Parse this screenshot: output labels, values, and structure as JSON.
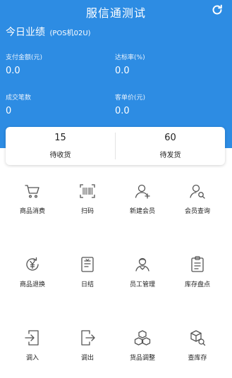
{
  "header": {
    "title": "服信通测试",
    "today_label": "今日业绩",
    "pos_label": "(POS机02U)",
    "refresh_icon": "refresh-icon",
    "bg_color": "#2d8ce3"
  },
  "metrics": [
    {
      "label": "支付金额(元)",
      "value": "0.0"
    },
    {
      "label": "达标率(%)",
      "value": "0.0"
    },
    {
      "label": "成交笔数",
      "value": "0"
    },
    {
      "label": "客单价(元)",
      "value": "0.0"
    }
  ],
  "pending": [
    {
      "count": "15",
      "label": "待收货"
    },
    {
      "count": "60",
      "label": "待发货"
    }
  ],
  "grid": [
    {
      "label": "商品消费",
      "icon": "cart-icon"
    },
    {
      "label": "扫码",
      "icon": "barcode-scan-icon"
    },
    {
      "label": "新建会员",
      "icon": "add-member-icon"
    },
    {
      "label": "会员查询",
      "icon": "member-search-icon"
    },
    {
      "label": "商品退换",
      "icon": "yen-return-icon"
    },
    {
      "label": "日结",
      "icon": "daily-settlement-icon"
    },
    {
      "label": "员工管理",
      "icon": "staff-icon"
    },
    {
      "label": "库存盘点",
      "icon": "inventory-check-icon"
    },
    {
      "label": "调入",
      "icon": "transfer-in-icon"
    },
    {
      "label": "调出",
      "icon": "transfer-out-icon"
    },
    {
      "label": "货品调整",
      "icon": "goods-adjust-icon"
    },
    {
      "label": "查库存",
      "icon": "stock-search-icon"
    }
  ]
}
